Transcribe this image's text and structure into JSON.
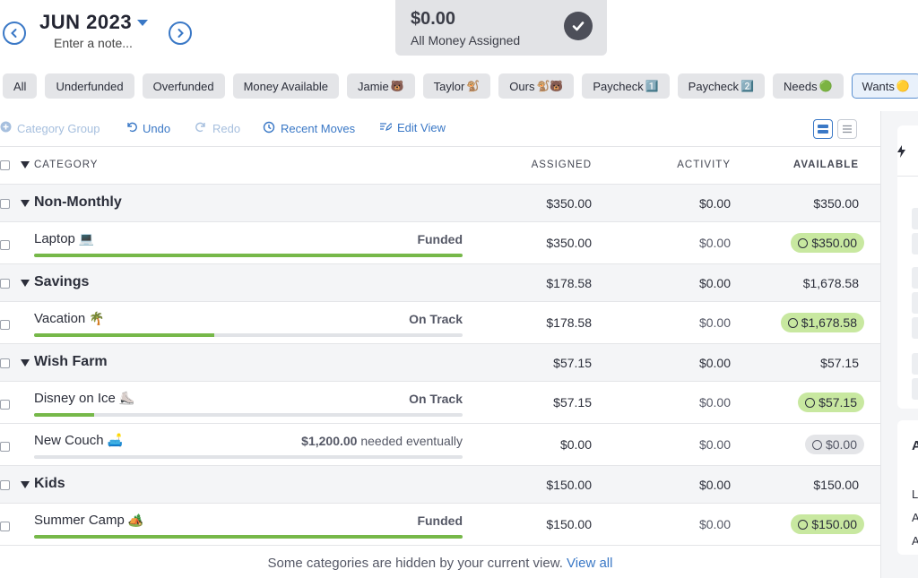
{
  "header": {
    "month": "JUN 2023",
    "note_placeholder": "Enter a note...",
    "ready_amount": "$0.00",
    "ready_label": "All Money Assigned"
  },
  "filters": [
    {
      "label": "All",
      "emoji": ""
    },
    {
      "label": "Underfunded",
      "emoji": ""
    },
    {
      "label": "Overfunded",
      "emoji": ""
    },
    {
      "label": "Money Available",
      "emoji": ""
    },
    {
      "label": "Jamie",
      "emoji": "🐻"
    },
    {
      "label": "Taylor",
      "emoji": "🐒"
    },
    {
      "label": "Ours",
      "emoji": "🐒🐻"
    },
    {
      "label": "Paycheck",
      "emoji": "1️⃣"
    },
    {
      "label": "Paycheck",
      "emoji": "2️⃣"
    },
    {
      "label": "Needs",
      "emoji": "🟢"
    },
    {
      "label": "Wants",
      "emoji": "🟡"
    }
  ],
  "toolbar": {
    "category_group": "Category Group",
    "undo": "Undo",
    "redo": "Redo",
    "recent_moves": "Recent Moves",
    "edit_view": "Edit View"
  },
  "columns": {
    "category": "CATEGORY",
    "assigned": "ASSIGNED",
    "activity": "ACTIVITY",
    "available": "AVAILABLE"
  },
  "groups": [
    {
      "name": "Non-Monthly",
      "assigned": "$350.00",
      "activity": "$0.00",
      "available": "$350.00"
    },
    {
      "name": "Savings",
      "assigned": "$178.58",
      "activity": "$0.00",
      "available": "$1,678.58"
    },
    {
      "name": "Wish Farm",
      "assigned": "$57.15",
      "activity": "$0.00",
      "available": "$57.15"
    },
    {
      "name": "Kids",
      "assigned": "$150.00",
      "activity": "$0.00",
      "available": "$150.00"
    }
  ],
  "categories": [
    {
      "name": "Laptop",
      "emoji": "💻",
      "status": "Funded",
      "status_suffix": "",
      "assigned": "$350.00",
      "activity": "$0.00",
      "available": "$350.00",
      "progress": 1.0,
      "pill": "green"
    },
    {
      "name": "Vacation",
      "emoji": "🌴",
      "status": "On Track",
      "status_suffix": "",
      "assigned": "$178.58",
      "activity": "$0.00",
      "available": "$1,678.58",
      "progress": 0.42,
      "pill": "green"
    },
    {
      "name": "Disney on Ice",
      "emoji": "⛸️",
      "status": "On Track",
      "status_suffix": "",
      "assigned": "$57.15",
      "activity": "$0.00",
      "available": "$57.15",
      "progress": 0.14,
      "pill": "green"
    },
    {
      "name": "New Couch",
      "emoji": "🛋️",
      "status": "$1,200.00",
      "status_suffix": " needed eventually",
      "assigned": "$0.00",
      "activity": "$0.00",
      "available": "$0.00",
      "progress": 0.0,
      "pill": "grey"
    },
    {
      "name": "Summer Camp",
      "emoji": "🏕️",
      "status": "Funded",
      "status_suffix": "",
      "assigned": "$150.00",
      "activity": "$0.00",
      "available": "$150.00",
      "progress": 1.0,
      "pill": "green"
    }
  ],
  "footer": {
    "hidden_note": "Some categories are hidden by your current view.",
    "view_all": "View all"
  },
  "right_panel": {
    "letters": [
      "A",
      "L",
      "A",
      "A"
    ]
  },
  "colors": {
    "accent": "#3a78c6",
    "progress_green": "#76b849",
    "pill_green": "#c8e8a0",
    "pill_grey": "#e4e5e8"
  }
}
